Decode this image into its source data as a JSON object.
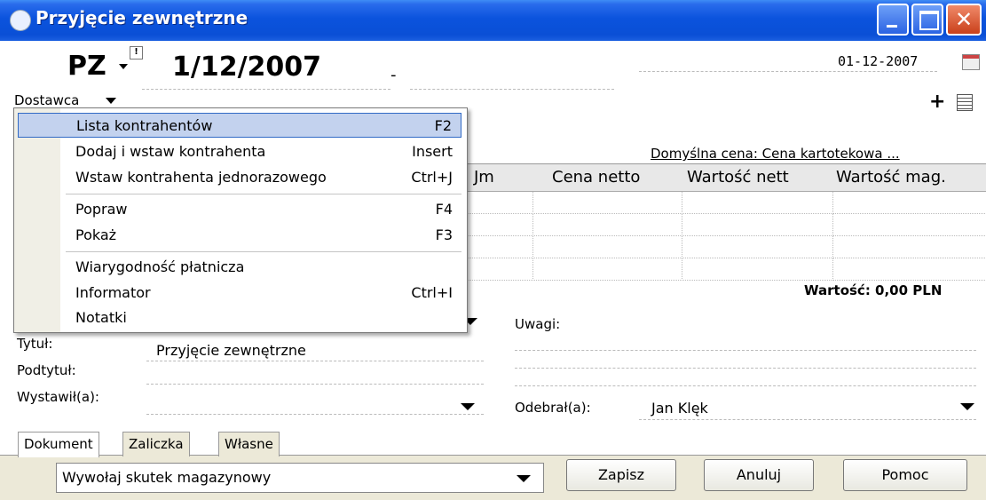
{
  "window": {
    "title": "Przyjęcie zewnętrzne"
  },
  "header": {
    "doc_type": "PZ",
    "doc_number": "1/12/2007",
    "dash": "-",
    "date": "01-12-2007"
  },
  "supplier": {
    "label": "Dostawca",
    "default_price": "Domyślna cena: Cena kartotekowa ..."
  },
  "menu": {
    "items": [
      {
        "label": "Lista kontrahentów",
        "shortcut": "F2"
      },
      {
        "label": "Dodaj i wstaw kontrahenta",
        "shortcut": "Insert"
      },
      {
        "label": "Wstaw kontrahenta jednorazowego",
        "shortcut": "Ctrl+J"
      },
      {
        "label": "Popraw",
        "shortcut": "F4"
      },
      {
        "label": "Pokaż",
        "shortcut": "F3"
      },
      {
        "label": "Wiarygodność płatnicza",
        "shortcut": ""
      },
      {
        "label": "Informator",
        "shortcut": "Ctrl+I"
      },
      {
        "label": "Notatki",
        "shortcut": ""
      }
    ]
  },
  "table": {
    "columns": [
      "Jm",
      "Cena netto",
      "Wartość nett",
      "Wartość mag."
    ],
    "total": "Wartość: 0,00 PLN"
  },
  "form": {
    "title_label": "Tytuł:",
    "title_value": "Przyjęcie zewnętrzne",
    "subtitle_label": "Podtytuł:",
    "issued_label": "Wystawił(a):",
    "notes_label": "Uwagi:",
    "received_label": "Odebrał(a):",
    "received_value": "Jan Klęk"
  },
  "tabs": [
    "Dokument",
    "Zaliczka",
    "Własne"
  ],
  "footer": {
    "action": "Wywołaj skutek magazynowy",
    "save": "Zapisz",
    "cancel": "Anuluj",
    "help": "Pomoc"
  }
}
